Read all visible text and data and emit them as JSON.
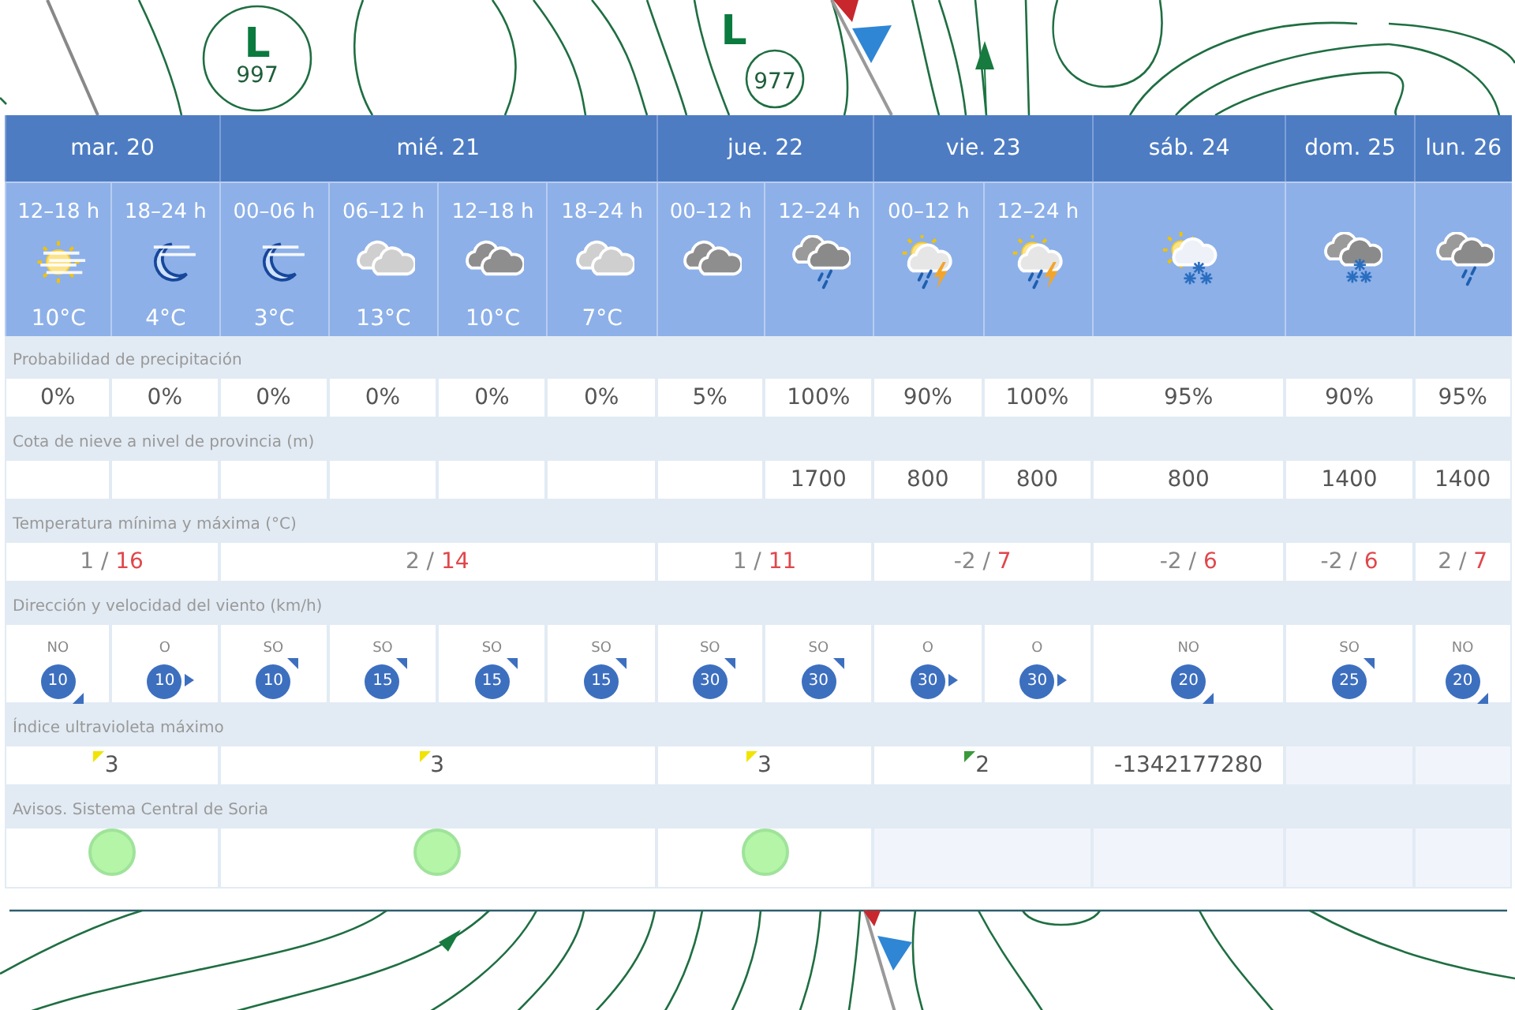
{
  "map_top": {
    "lows": [
      {
        "letter": "L",
        "pressure": "997"
      },
      {
        "letter": "L",
        "pressure": "977"
      }
    ]
  },
  "days": [
    {
      "label": "mar. 20",
      "periods": [
        {
          "time": "12–18 h",
          "kind": "sunhaze",
          "temp": "10°C"
        },
        {
          "time": "18–24 h",
          "kind": "moonhaze",
          "temp": "4°C"
        }
      ]
    },
    {
      "label": "mié. 21",
      "periods": [
        {
          "time": "00–06 h",
          "kind": "moonhaze",
          "temp": "3°C"
        },
        {
          "time": "06–12 h",
          "kind": "cloudlight",
          "temp": "13°C"
        },
        {
          "time": "12–18 h",
          "kind": "clouddark",
          "temp": "10°C"
        },
        {
          "time": "18–24 h",
          "kind": "cloudlight",
          "temp": "7°C"
        }
      ]
    },
    {
      "label": "jue. 22",
      "periods": [
        {
          "time": "00–12 h",
          "kind": "clouddark"
        },
        {
          "time": "12–24 h",
          "kind": "rain"
        }
      ]
    },
    {
      "label": "vie. 23",
      "periods": [
        {
          "time": "00–12 h",
          "kind": "sunstorm"
        },
        {
          "time": "12–24 h",
          "kind": "sunstorm"
        }
      ]
    },
    {
      "label": "sáb. 24",
      "periods": [
        {
          "kind": "sunsnow"
        }
      ]
    },
    {
      "label": "dom. 25",
      "periods": [
        {
          "kind": "snow"
        }
      ]
    },
    {
      "label": "lun. 26",
      "periods": [
        {
          "kind": "rain"
        }
      ]
    }
  ],
  "rows": [
    {
      "kind": "per_period",
      "label": "Probabilidad de precipitación",
      "cells": [
        "0%",
        "0%",
        "0%",
        "0%",
        "0%",
        "0%",
        "5%",
        "100%",
        "90%",
        "100%",
        "95%",
        "90%",
        "95%"
      ]
    },
    {
      "kind": "per_period",
      "label": "Cota de nieve a nivel de provincia (m)",
      "cells": [
        null,
        null,
        null,
        null,
        null,
        null,
        null,
        "1700",
        "800",
        "800",
        "800",
        "1400",
        "1400"
      ]
    },
    {
      "kind": "temperature",
      "label": "Temperatura mínima y máxima (°C)",
      "cells": [
        {
          "min": "1 /",
          "max": "16"
        },
        {
          "min": "2 /",
          "max": "14"
        },
        {
          "min": "1 /",
          "max": "11"
        },
        {
          "min": "-2 /",
          "max": "7"
        },
        {
          "min": "-2 /",
          "max": "6"
        },
        {
          "min": "-2 /",
          "max": "6"
        },
        {
          "min": "2 /",
          "max": "7"
        }
      ]
    },
    {
      "kind": "wind",
      "label": "Dirección y velocidad del viento (km/h)",
      "cells": [
        {
          "direction": "NO",
          "speed": "10",
          "kind": "southeast"
        },
        {
          "direction": "O",
          "speed": "10",
          "kind": "east"
        },
        {
          "direction": "SO",
          "speed": "10",
          "kind": "northeast"
        },
        {
          "direction": "SO",
          "speed": "15",
          "kind": "northeast"
        },
        {
          "direction": "SO",
          "speed": "15",
          "kind": "northeast"
        },
        {
          "direction": "SO",
          "speed": "15",
          "kind": "northeast"
        },
        {
          "direction": "SO",
          "speed": "30",
          "kind": "northeast"
        },
        {
          "direction": "SO",
          "speed": "30",
          "kind": "northeast"
        },
        {
          "direction": "O",
          "speed": "30",
          "kind": "east"
        },
        {
          "direction": "O",
          "speed": "30",
          "kind": "east"
        },
        {
          "direction": "NO",
          "speed": "20",
          "kind": "southeast"
        },
        {
          "direction": "SO",
          "speed": "25",
          "kind": "northeast"
        },
        {
          "direction": "NO",
          "speed": "20",
          "kind": "southeast"
        }
      ]
    },
    {
      "kind": "uv",
      "label": "Índice ultravioleta máximo",
      "cells": [
        {
          "available": true,
          "value": "3",
          "color": "#f0e400"
        },
        {
          "available": true,
          "value": "3",
          "color": "#f0e400"
        },
        {
          "available": true,
          "value": "3",
          "color": "#f0e400"
        },
        {
          "available": true,
          "value": "2",
          "color": "#3a9a3a"
        },
        {
          "available": true,
          "value": "-1342177280"
        },
        {
          "available": false
        },
        {
          "available": false
        }
      ]
    },
    {
      "kind": "warning",
      "label": "Avisos. Sistema Central de Soria",
      "cells": [
        {
          "warning": true,
          "color": "#b4f5a8"
        },
        {
          "warning": true,
          "color": "#b4f5a8"
        },
        {
          "warning": true,
          "color": "#b4f5a8"
        },
        {
          "warning": false
        },
        {
          "warning": false
        },
        {
          "warning": false
        },
        {
          "warning": false
        }
      ]
    }
  ]
}
